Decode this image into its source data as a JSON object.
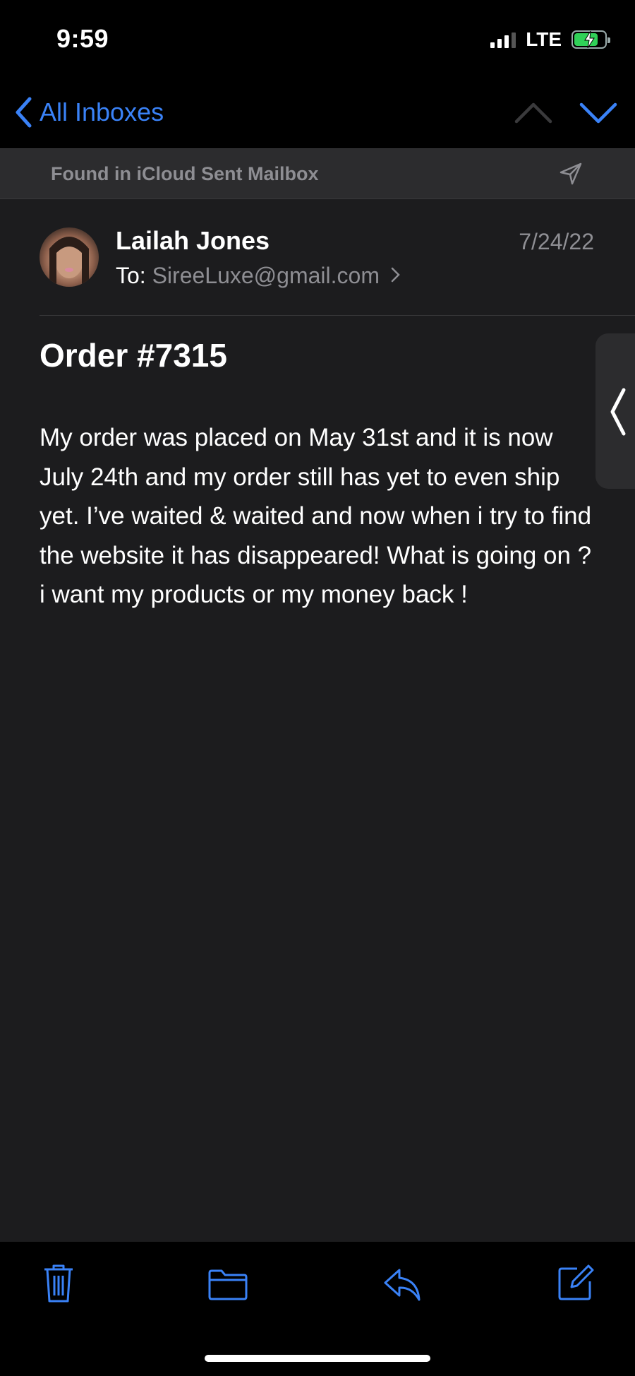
{
  "status": {
    "time": "9:59",
    "network": "LTE"
  },
  "nav": {
    "back_label": "All Inboxes"
  },
  "banner": {
    "text": "Found in iCloud Sent Mailbox"
  },
  "message": {
    "sender": "Lailah Jones",
    "to_prefix": "To:",
    "to_address": "SireeLuxe@gmail.com",
    "date": "7/24/22",
    "subject": "Order #7315",
    "body": "My order was placed on May 31st and it is now July 24th and my order still has yet to even ship yet. I’ve waited & waited and now when i try to find the website it has disappeared! What is going on ? i want my products or my money back !"
  },
  "colors": {
    "accent": "#3a82f7",
    "background": "#1c1c1e",
    "secondary_text": "#8e8e93"
  },
  "icons": [
    "chevron-left-icon",
    "chevron-up-icon",
    "chevron-down-icon",
    "send-icon",
    "trash-icon",
    "folder-icon",
    "reply-icon",
    "compose-icon"
  ]
}
